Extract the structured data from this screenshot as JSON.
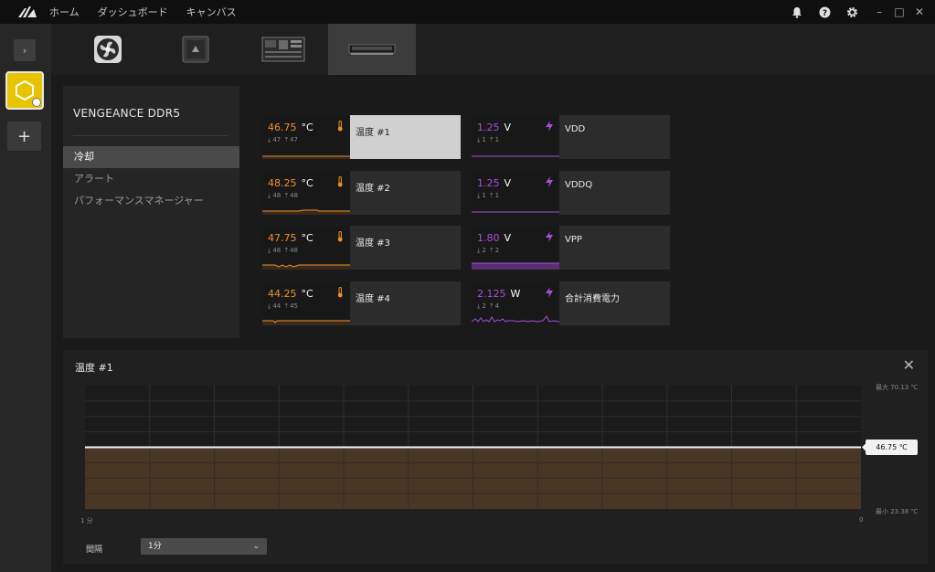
{
  "titlebar": {
    "nav": [
      "ホーム",
      "ダッシュボード",
      "キャンバス"
    ],
    "window_controls": [
      "–",
      "□",
      "✕"
    ]
  },
  "rail": {
    "expand_label": "›",
    "add_label": "+"
  },
  "side_panel": {
    "device_name": "VENGEANCE DDR5",
    "items": [
      {
        "label": "冷却",
        "active": true
      },
      {
        "label": "アラート",
        "active": false
      },
      {
        "label": "パフォーマンスマネージャー",
        "active": false
      }
    ]
  },
  "sensors": [
    {
      "value": "46.75",
      "unit": "°C",
      "min": "47",
      "max": "47",
      "name": "温度 #1",
      "kind": "temp",
      "selected": true
    },
    {
      "value": "48.25",
      "unit": "°C",
      "min": "48",
      "max": "48",
      "name": "温度 #2",
      "kind": "temp",
      "selected": false
    },
    {
      "value": "47.75",
      "unit": "°C",
      "min": "48",
      "max": "48",
      "name": "温度 #3",
      "kind": "temp",
      "selected": false
    },
    {
      "value": "44.25",
      "unit": "°C",
      "min": "44",
      "max": "45",
      "name": "温度 #4",
      "kind": "temp",
      "selected": false
    },
    {
      "value": "1.25",
      "unit": "V",
      "min": "1",
      "max": "1",
      "name": "VDD",
      "kind": "power",
      "selected": false
    },
    {
      "value": "1.25",
      "unit": "V",
      "min": "1",
      "max": "1",
      "name": "VDDQ",
      "kind": "power",
      "selected": false
    },
    {
      "value": "1.80",
      "unit": "V",
      "min": "2",
      "max": "2",
      "name": "VPP",
      "kind": "power",
      "selected": false
    },
    {
      "value": "2.125",
      "unit": "W",
      "min": "2",
      "max": "4",
      "name": "合計消費電力",
      "kind": "power",
      "selected": false
    }
  ],
  "graph": {
    "title": "温度 #1",
    "close_label": "✕",
    "max_label": "最大 70.13 ℃",
    "min_label": "最小 23.38 ℃",
    "current_label": "46.75 ℃",
    "x_start_label": "1 分",
    "x_end_label": "0",
    "interval_label": "間隔",
    "interval_value": "1分",
    "interval_chevron": "⌄"
  },
  "colors": {
    "temp_accent": "#f0902a",
    "power_accent": "#a84de0",
    "brand_yellow": "#e8c400"
  },
  "chart_data": {
    "type": "area",
    "x": [
      "1 分",
      "0"
    ],
    "values": [
      46.75,
      46.75
    ],
    "ylim": [
      23.38,
      70.13
    ],
    "current": 46.75,
    "grid": true
  }
}
